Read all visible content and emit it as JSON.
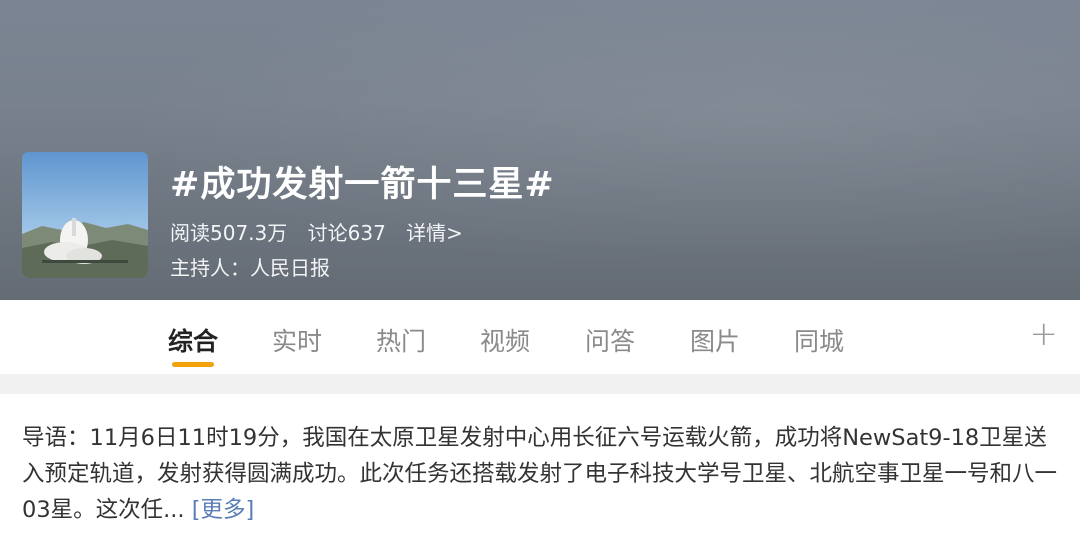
{
  "topic": {
    "title": "#成功发射一箭十三星#",
    "stats": {
      "reads": "阅读507.3万",
      "discussions": "讨论637",
      "details": "详情>"
    },
    "host": "主持人：人民日报"
  },
  "tabs": [
    {
      "label": "综合",
      "active": true
    },
    {
      "label": "实时",
      "active": false
    },
    {
      "label": "热门",
      "active": false
    },
    {
      "label": "视频",
      "active": false
    },
    {
      "label": "问答",
      "active": false
    },
    {
      "label": "图片",
      "active": false
    },
    {
      "label": "同城",
      "active": false
    }
  ],
  "add_tab_icon": "+",
  "intro": {
    "text": "导语：11月6日11时19分，我国在太原卫星发射中心用长征六号运载火箭，成功将NewSat9-18卫星送入预定轨道，发射获得圆满成功。此次任务还搭载发射了电子科技大学号卫星、北航空事卫星一号和八一03星。这次任...",
    "more_link": "[更多]"
  },
  "colors": {
    "accent": "#f0a30a",
    "link": "#5a7db8"
  }
}
